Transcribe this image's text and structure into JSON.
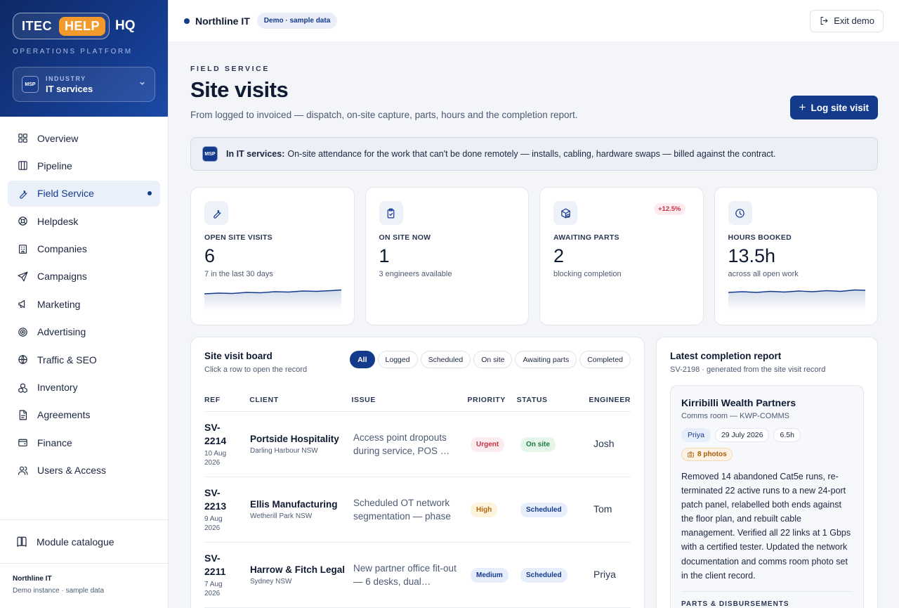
{
  "sidebar": {
    "logo": {
      "itec": "ITEC",
      "help": "HELP",
      "hq": "HQ"
    },
    "subtitle": "OPERATIONS PLATFORM",
    "industry": {
      "badge": "MSP",
      "label": "INDUSTRY",
      "value": "IT services"
    },
    "items": [
      {
        "label": "Overview",
        "icon": "grid-icon"
      },
      {
        "label": "Pipeline",
        "icon": "pipeline-icon"
      },
      {
        "label": "Field Service",
        "icon": "wrench-icon",
        "active": true
      },
      {
        "label": "Helpdesk",
        "icon": "lifebuoy-icon"
      },
      {
        "label": "Companies",
        "icon": "building-icon"
      },
      {
        "label": "Campaigns",
        "icon": "send-icon"
      },
      {
        "label": "Marketing",
        "icon": "megaphone-icon"
      },
      {
        "label": "Advertising",
        "icon": "target-icon"
      },
      {
        "label": "Traffic & SEO",
        "icon": "globe-icon"
      },
      {
        "label": "Inventory",
        "icon": "boxes-icon"
      },
      {
        "label": "Agreements",
        "icon": "document-icon"
      },
      {
        "label": "Finance",
        "icon": "wallet-icon"
      },
      {
        "label": "Users & Access",
        "icon": "users-icon"
      }
    ],
    "module_catalogue": "Module catalogue",
    "org_name": "Northline IT",
    "org_sub": "Demo instance · sample data"
  },
  "topbar": {
    "org": "Northline IT",
    "badge": "Demo · sample data",
    "exit": "Exit demo"
  },
  "header": {
    "eyebrow": "FIELD SERVICE",
    "title": "Site visits",
    "subtitle": "From logged to invoiced — dispatch, on-site capture, parts, hours and the completion report.",
    "log_button": "Log site visit"
  },
  "infobar": {
    "badge": "MSP",
    "lead": "In IT services:",
    "text": "On-site attendance for the work that can't be done remotely — installs, cabling, hardware swaps — billed against the contract."
  },
  "kpis": [
    {
      "label": "OPEN SITE VISITS",
      "value": "6",
      "note": "7 in the last 30 days",
      "icon": "wrench-icon"
    },
    {
      "label": "ON SITE NOW",
      "value": "1",
      "note": "3 engineers available",
      "icon": "clipboard-icon"
    },
    {
      "label": "AWAITING PARTS",
      "value": "2",
      "note": "blocking completion",
      "icon": "package-icon",
      "delta": "+12.5%"
    },
    {
      "label": "HOURS BOOKED",
      "value": "13.5h",
      "note": "across all open work",
      "icon": "clock-icon"
    }
  ],
  "board": {
    "title": "Site visit board",
    "subtitle": "Click a row to open the record",
    "filters": [
      "All",
      "Logged",
      "Scheduled",
      "On site",
      "Awaiting parts",
      "Completed"
    ],
    "active_filter": "All",
    "columns": [
      "REF",
      "CLIENT",
      "ISSUE",
      "PRIORITY",
      "STATUS",
      "ENGINEER"
    ],
    "rows": [
      {
        "ref": "SV-2214",
        "date": "10 Aug 2026",
        "client": "Portside Hospitality",
        "location": "Darling Harbour NSW",
        "issue": "Access point dropouts during service, POS …",
        "priority": "Urgent",
        "status": "On site",
        "engineer": "Josh"
      },
      {
        "ref": "SV-2213",
        "date": "9 Aug 2026",
        "client": "Ellis Manufacturing",
        "location": "Wetherill Park NSW",
        "issue": "Scheduled OT network segmentation — phase …",
        "priority": "High",
        "status": "Scheduled",
        "engineer": "Tom"
      },
      {
        "ref": "SV-2211",
        "date": "7 Aug 2026",
        "client": "Harrow & Fitch Legal",
        "location": "Sydney NSW",
        "issue": "New partner office fit-out — 6 desks, dual…",
        "priority": "Medium",
        "status": "Scheduled",
        "engineer": "Priya"
      }
    ]
  },
  "report": {
    "title": "Latest completion report",
    "subtitle": "SV-2198 · generated from the site visit record",
    "client": "Kirribilli Wealth Partners",
    "site": "Comms room — KWP-COMMS",
    "tags": [
      "Priya",
      "29 July 2026",
      "6.5h"
    ],
    "photos": "8 photos",
    "body": "Removed 14 abandoned Cat5e runs, re-terminated 22 active runs to a new 24-port patch panel, relabelled both ends against the floor plan, and rebuilt cable management. Verified all 22 links at 1 Gbps with a certified tester. Updated the network documentation and comms room photo set in the client record.",
    "section": "PARTS & DISBURSEMENTS"
  }
}
